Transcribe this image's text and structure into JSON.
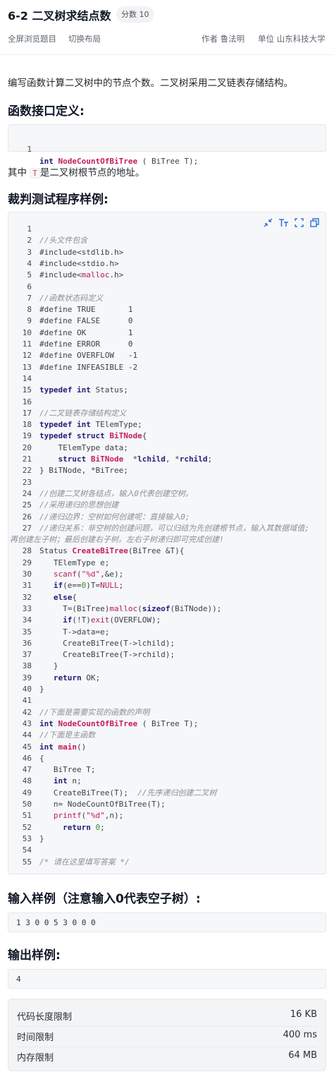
{
  "problem": {
    "title": "6-2 二叉树求结点数",
    "score": "分数 10"
  },
  "toolbar": {
    "fullscreen": "全屏浏览题目",
    "switch_layout": "切换布局",
    "author_label": "作者",
    "author": "鲁法明",
    "unit_label": "单位",
    "unit": "山东科技大学"
  },
  "description": "编写函数计算二叉树中的节点个数。二叉树采用二叉链表存储结构。",
  "sections": {
    "func_def": "函数接口定义:",
    "judge": "裁判测试程序样例:",
    "input_sample": "输入样例（注意输入0代表空子树）:",
    "output_sample": "输出样例:"
  },
  "func_code": {
    "line_no": "1",
    "kw": "int",
    "fn": "NodeCountOfBiTree",
    "rest": " ( BiTree T);"
  },
  "param_text": {
    "prefix": "其中",
    "code": "T",
    "suffix": "是二叉树根节点的地址。"
  },
  "code_tools": {
    "collapse": "collapse-icon",
    "font": "font-size-icon",
    "fullscreen": "fullscreen-icon",
    "copy": "copy-icon"
  },
  "code_lines": [
    {
      "n": "1",
      "t": ""
    },
    {
      "n": "2",
      "t": "//头文件包含",
      "c": "cm"
    },
    {
      "n": "3",
      "t": "#include<stdlib.h>"
    },
    {
      "n": "4",
      "t": "#include<stdio.h>"
    },
    {
      "n": "5",
      "t": "#include<malloc.h>"
    },
    {
      "n": "6",
      "t": ""
    },
    {
      "n": "7",
      "t": "//函数状态码定义",
      "c": "cm"
    },
    {
      "n": "8",
      "t": "#define TRUE       1"
    },
    {
      "n": "9",
      "t": "#define FALSE      0"
    },
    {
      "n": "10",
      "t": "#define OK         1"
    },
    {
      "n": "11",
      "t": "#define ERROR      0"
    },
    {
      "n": "12",
      "t": "#define OVERFLOW   -1"
    },
    {
      "n": "13",
      "t": "#define INFEASIBLE -2"
    },
    {
      "n": "14",
      "t": ""
    },
    {
      "n": "15",
      "t": "typedef int Status;"
    },
    {
      "n": "16",
      "t": ""
    },
    {
      "n": "17",
      "t": "//二叉链表存储结构定义",
      "c": "cm"
    },
    {
      "n": "18",
      "t": "typedef int TElemType;"
    },
    {
      "n": "19",
      "t": "typedef struct BiTNode{"
    },
    {
      "n": "20",
      "t": "    TElemType data;"
    },
    {
      "n": "21",
      "t": "    struct BiTNode  *lchild, *rchild;"
    },
    {
      "n": "22",
      "t": "} BiTNode, *BiTree;"
    },
    {
      "n": "23",
      "t": ""
    },
    {
      "n": "24",
      "t": "//创建二叉树各结点，输入0代表创建空树。",
      "c": "cm"
    },
    {
      "n": "25",
      "t": "//采用递归的思想创建",
      "c": "cm"
    },
    {
      "n": "26",
      "t": "//递归边界：空树如何创建呢：直接输入0;",
      "c": "cm"
    },
    {
      "n": "27",
      "t": "//递归关系：非空树的创建问题，可以归结为先创建根节点，输入其数据域值;",
      "c": "cm"
    },
    {
      "n": "",
      "t": "再创建左子树；最后创建右子树。左右子树递归即可完成创建!",
      "c": "cm"
    },
    {
      "n": "28",
      "t": "Status CreateBiTree(BiTree &T){"
    },
    {
      "n": "29",
      "t": "   TElemType e;"
    },
    {
      "n": "30",
      "t": "   scanf(\"%d\",&e);"
    },
    {
      "n": "31",
      "t": "   if(e==0)T=NULL;"
    },
    {
      "n": "32",
      "t": "   else{"
    },
    {
      "n": "33",
      "t": "     T=(BiTree)malloc(sizeof(BiTNode));"
    },
    {
      "n": "34",
      "t": "     if(!T)exit(OVERFLOW);"
    },
    {
      "n": "35",
      "t": "     T->data=e;"
    },
    {
      "n": "36",
      "t": "     CreateBiTree(T->lchild);"
    },
    {
      "n": "37",
      "t": "     CreateBiTree(T->rchild);"
    },
    {
      "n": "38",
      "t": "   }"
    },
    {
      "n": "39",
      "t": "   return OK;"
    },
    {
      "n": "40",
      "t": "}"
    },
    {
      "n": "41",
      "t": ""
    },
    {
      "n": "42",
      "t": "//下面是需要实现的函数的声明",
      "c": "cm"
    },
    {
      "n": "43",
      "t": "int NodeCountOfBiTree ( BiTree T);"
    },
    {
      "n": "44",
      "t": "//下面是主函数",
      "c": "cm"
    },
    {
      "n": "45",
      "t": "int main()"
    },
    {
      "n": "46",
      "t": "{"
    },
    {
      "n": "47",
      "t": "   BiTree T;"
    },
    {
      "n": "48",
      "t": "   int n;"
    },
    {
      "n": "49",
      "t": "   CreateBiTree(T);  //先序递归创建二叉树"
    },
    {
      "n": "50",
      "t": "   n= NodeCountOfBiTree(T);"
    },
    {
      "n": "51",
      "t": "   printf(\"%d\",n);"
    },
    {
      "n": "52",
      "t": "     return 0;"
    },
    {
      "n": "53",
      "t": "}"
    },
    {
      "n": "54",
      "t": ""
    },
    {
      "n": "55",
      "t": "/* 请在这里填写答案 */",
      "c": "cm"
    }
  ],
  "samples": {
    "input": "1 3 0 0 5 3 0 0 0",
    "output": "4"
  },
  "limits": [
    {
      "label": "代码长度限制",
      "value": "16 KB"
    },
    {
      "label": "时间限制",
      "value": "400 ms"
    },
    {
      "label": "内存限制",
      "value": "64 MB"
    }
  ]
}
